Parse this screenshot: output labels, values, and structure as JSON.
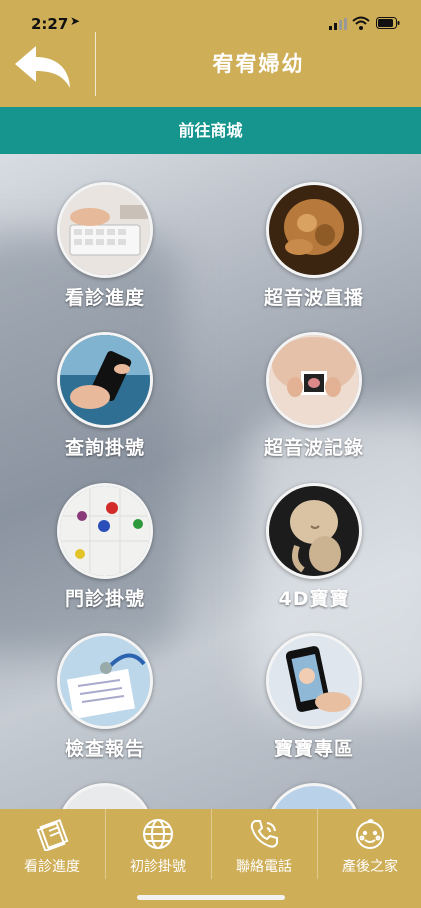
{
  "status": {
    "time": "2:27"
  },
  "header": {
    "title": "宥宥婦幼"
  },
  "shop_link": {
    "label": "前往商城"
  },
  "grid": {
    "items": [
      {
        "label": "看診進度"
      },
      {
        "label": "超音波直播"
      },
      {
        "label": "查詢掛號"
      },
      {
        "label": "超音波記錄"
      },
      {
        "label": "門診掛號"
      },
      {
        "label": "4D寶寶"
      },
      {
        "label": "檢查報告"
      },
      {
        "label": "寶寶專區"
      }
    ]
  },
  "tabbar": {
    "tabs": [
      {
        "label": "看診進度",
        "icon": "document-stack-icon"
      },
      {
        "label": "初診掛號",
        "icon": "globe-icon"
      },
      {
        "label": "聯絡電話",
        "icon": "phone-icon"
      },
      {
        "label": "產後之家",
        "icon": "baby-face-icon"
      }
    ]
  },
  "colors": {
    "header": "#cfae58",
    "shop_bar": "#15958e"
  }
}
